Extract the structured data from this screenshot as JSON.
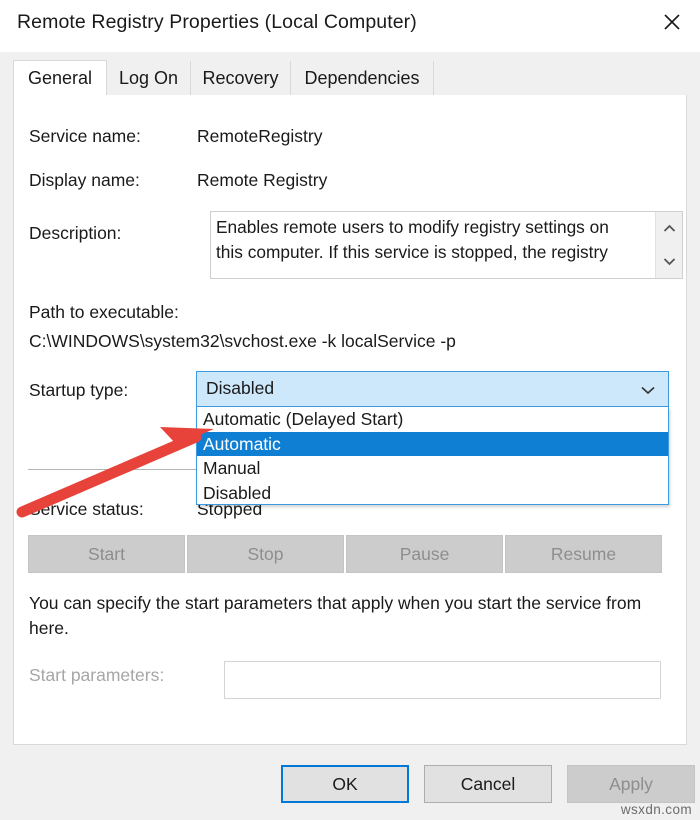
{
  "window": {
    "title": "Remote Registry Properties (Local Computer)",
    "close_icon": "close-icon"
  },
  "tabs": [
    {
      "label": "General",
      "active": true
    },
    {
      "label": "Log On",
      "active": false
    },
    {
      "label": "Recovery",
      "active": false
    },
    {
      "label": "Dependencies",
      "active": false
    }
  ],
  "general": {
    "service_name_label": "Service name:",
    "service_name_value": "RemoteRegistry",
    "display_name_label": "Display name:",
    "display_name_value": "Remote Registry",
    "description_label": "Description:",
    "description_value": "Enables remote users to modify registry settings on this computer. If this service is stopped, the registry",
    "path_label": "Path to executable:",
    "path_value": "C:\\WINDOWS\\system32\\svchost.exe -k localService -p",
    "startup_type_label": "Startup type:",
    "startup_type_value": "Disabled",
    "startup_options": [
      {
        "label": "Automatic (Delayed Start)",
        "selected": false
      },
      {
        "label": "Automatic",
        "selected": true
      },
      {
        "label": "Manual",
        "selected": false
      },
      {
        "label": "Disabled",
        "selected": false
      }
    ],
    "service_status_label": "Service status:",
    "service_status_value": "Stopped",
    "control_buttons": [
      {
        "label": "Start",
        "enabled": false
      },
      {
        "label": "Stop",
        "enabled": false
      },
      {
        "label": "Pause",
        "enabled": false
      },
      {
        "label": "Resume",
        "enabled": false
      }
    ],
    "help_text": "You can specify the start parameters that apply when you start the service from here.",
    "start_parameters_label": "Start parameters:",
    "start_parameters_value": ""
  },
  "footer": {
    "ok_label": "OK",
    "cancel_label": "Cancel",
    "apply_label": "Apply"
  },
  "watermark": "wsxdn.com",
  "colors": {
    "accent_blue": "#0078d7",
    "selection_blue": "#0f7fd4",
    "combo_fill": "#cde8fa",
    "annotation_red": "#e8433a",
    "dialog_bg": "#f0f0f0",
    "panel_bg": "#ffffff",
    "disabled_text": "#8e8e8e"
  }
}
